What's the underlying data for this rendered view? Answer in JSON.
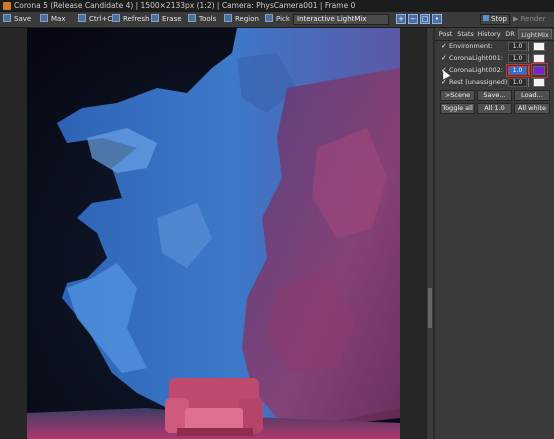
{
  "window": {
    "title": "Corona 5 (Release Candidate 4) | 1500×2133px (1:2) | Camera: PhysCamera001 | Frame 0"
  },
  "toolbar": {
    "save_label": "Save",
    "max_label": "Max",
    "ctrlc_label": "Ctrl+C",
    "refresh_label": "Refresh",
    "erase_label": "Erase",
    "tools_label": "Tools",
    "region_label": "Region",
    "pick_label": "Pick",
    "lightmix_select": "Interactive LightMix",
    "stop_label": "Stop",
    "render_label": "Render"
  },
  "panel": {
    "tabs": [
      "Post",
      "Stats",
      "History",
      "DR",
      "LightMix"
    ],
    "lights": [
      {
        "checked": true,
        "label": "Environment:",
        "value": "1.0",
        "color": "#f4f4f4"
      },
      {
        "checked": true,
        "label": "CoronaLight001:",
        "value": "1.0",
        "color": "#f4f4f4"
      },
      {
        "checked": true,
        "label": "CoronaLight002:",
        "value": "1.0",
        "color": "#7c1fd6"
      },
      {
        "checked": true,
        "label": "Rest (unassigned):",
        "value": "1.0",
        "color": "#f4f4f4"
      }
    ],
    "check_glyph": "✓",
    "buttons_row1": [
      ">Scene",
      "Save...",
      "Load..."
    ],
    "buttons_row2": [
      "Toggle all",
      "All 1.0",
      "All white"
    ]
  }
}
